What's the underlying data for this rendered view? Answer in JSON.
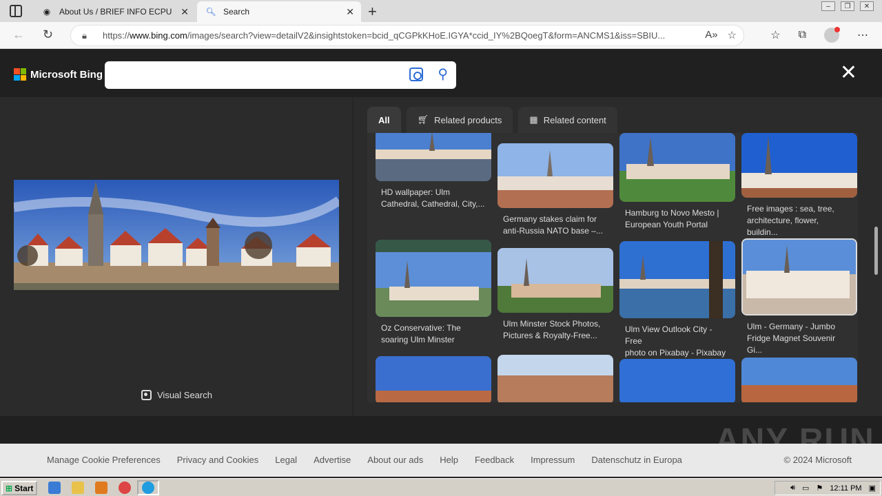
{
  "browser": {
    "tabs": [
      {
        "title": "About Us / BRIEF INFO ECPU",
        "icon": "site-favicon"
      },
      {
        "title": "Search",
        "icon": "search-favicon"
      }
    ],
    "url_prefix": "https://",
    "url_domain": "www.bing.com",
    "url_rest": "/images/search?view=detailV2&insightstoken=bcid_qCGPkKHoE.IGYA*ccid_IY%2BQoegT&form=ANCMS1&iss=SBIU..."
  },
  "bing": {
    "brand": "Microsoft Bing",
    "search_value": "",
    "visual_search_label": "Visual Search",
    "tabs": [
      {
        "label": "All"
      },
      {
        "label": "Related products"
      },
      {
        "label": "Related content"
      }
    ]
  },
  "results": [
    {
      "caption": "HD wallpaper: Ulm\nCathedral, Cathedral, City,..."
    },
    {
      "caption": "Germany stakes claim for\nanti-Russia NATO base –..."
    },
    {
      "caption": "Hamburg to Novo Mesto |\nEuropean Youth Portal"
    },
    {
      "caption": "Free images : sea, tree,\narchitecture, flower, buildin..."
    },
    {
      "caption": "Oz Conservative: The\nsoaring Ulm Minster"
    },
    {
      "caption": "Ulm Minster Stock Photos,\nPictures & Royalty-Free..."
    },
    {
      "caption": "Ulm View Outlook City - Free\nphoto on Pixabay - Pixabay"
    },
    {
      "caption": "Ulm - Germany - Jumbo\nFridge Magnet Souvenir Gi..."
    }
  ],
  "footer": {
    "links": [
      "Manage Cookie Preferences",
      "Privacy and Cookies",
      "Legal",
      "Advertise",
      "About our ads",
      "Help",
      "Feedback",
      "Impressum",
      "Datenschutz in Europa"
    ],
    "copyright": "© 2024 Microsoft"
  },
  "watermark": "ANY RUN",
  "taskbar": {
    "start_label": "Start",
    "clock": "12:11 PM"
  }
}
